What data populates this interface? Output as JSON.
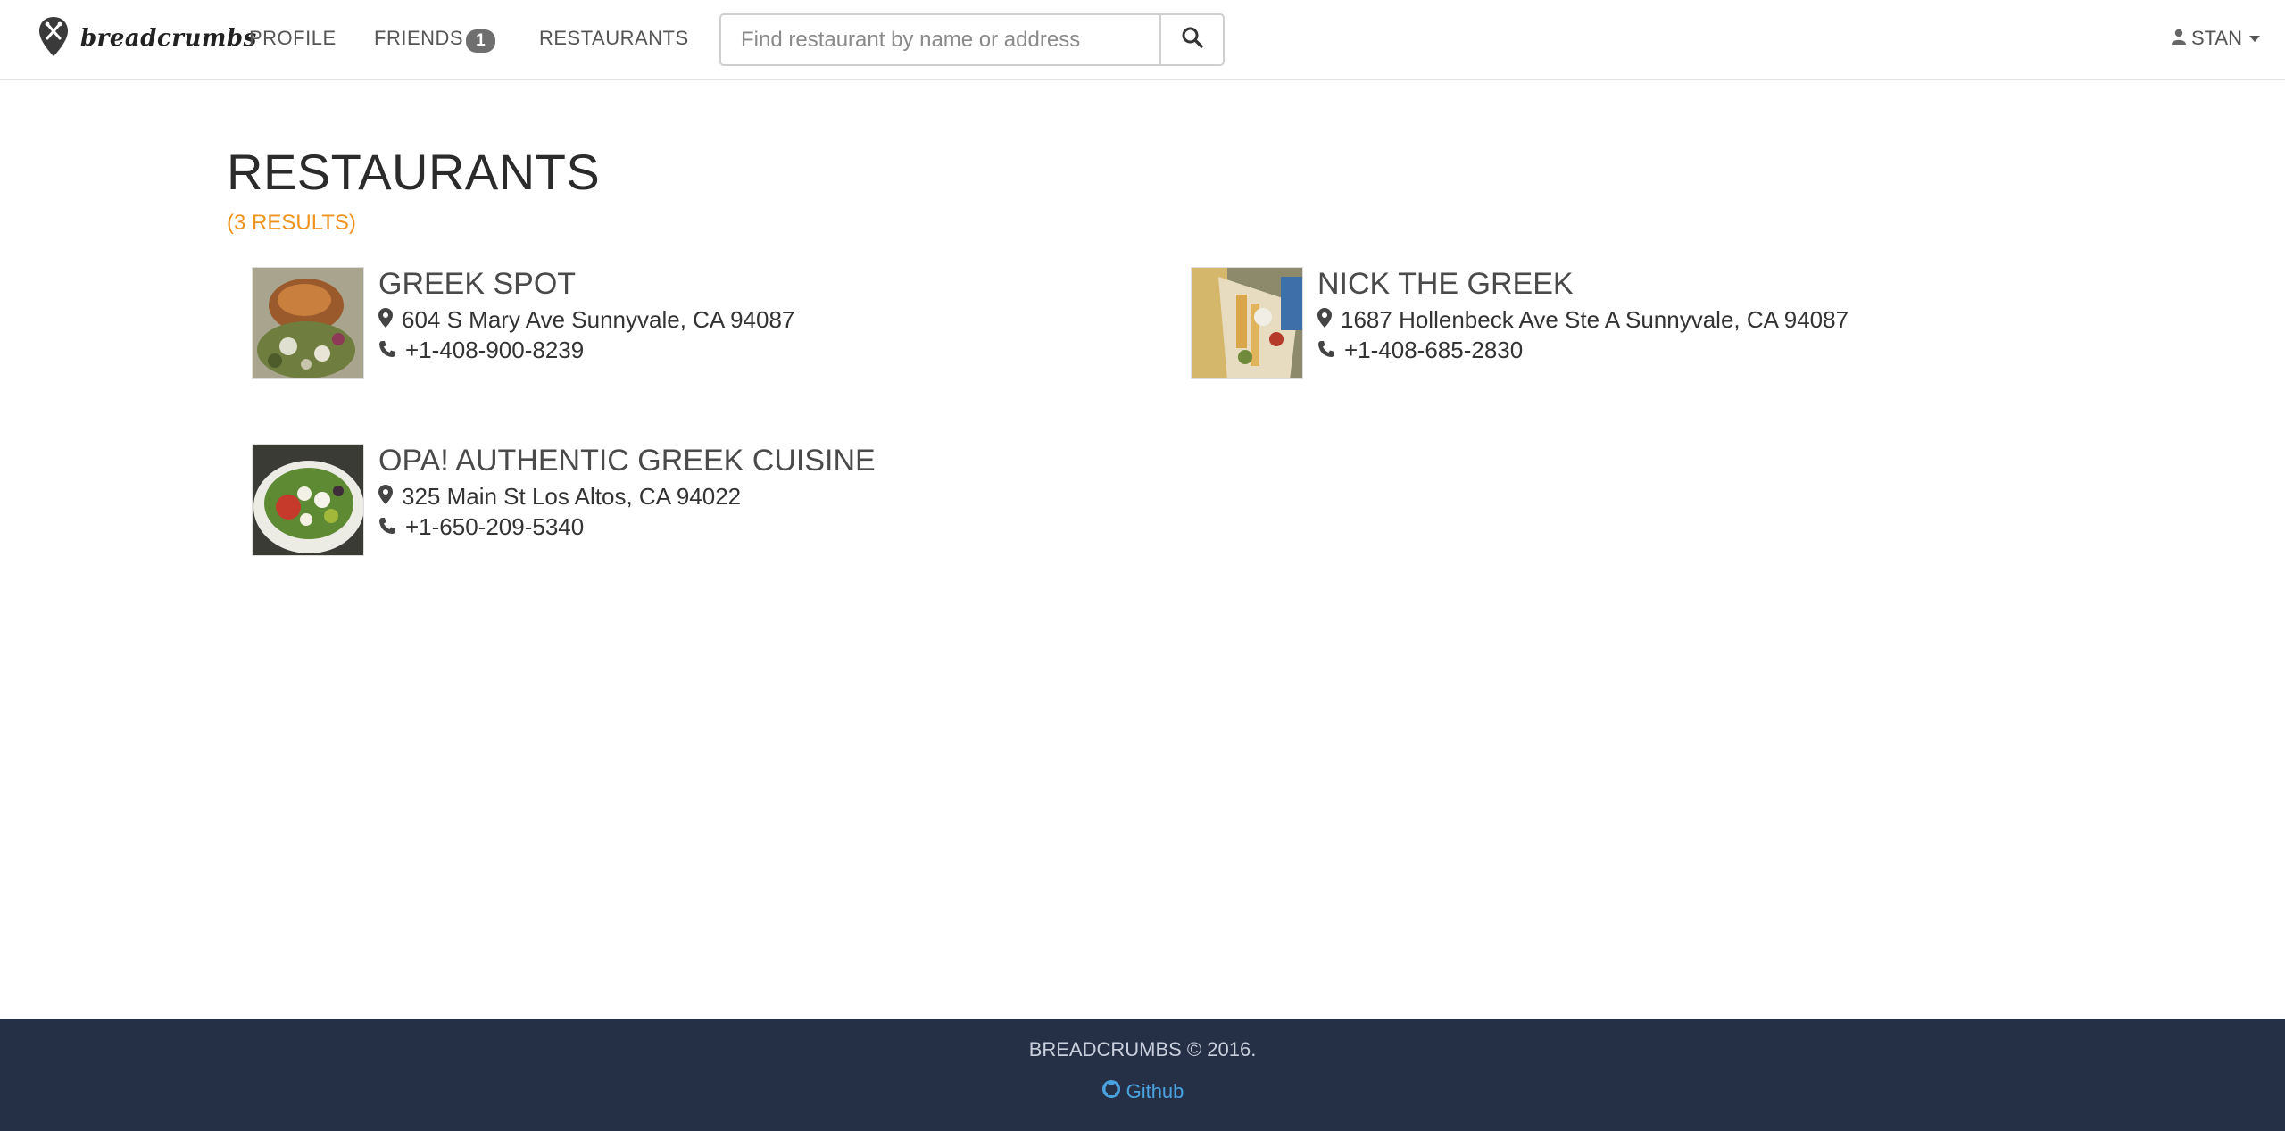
{
  "brand": {
    "name": "breadcrumbs",
    "logo_icon": "map-pin-utensils-icon"
  },
  "nav": {
    "profile": "PROFILE",
    "friends": "FRIENDS",
    "friends_badge": "1",
    "restaurants": "RESTAURANTS"
  },
  "search": {
    "placeholder": "Find restaurant by name or address",
    "value": "",
    "icon": "search-icon"
  },
  "user": {
    "name": "STAN",
    "icon": "user-icon"
  },
  "main": {
    "title": "RESTAURANTS",
    "results": "(3 RESULTS)"
  },
  "restaurants": [
    {
      "name": "GREEK SPOT",
      "address": "604 S Mary Ave Sunnyvale, CA 94087",
      "phone": "+1-408-900-8239"
    },
    {
      "name": "NICK THE GREEK",
      "address": "1687 Hollenbeck Ave Ste A Sunnyvale, CA 94087",
      "phone": "+1-408-685-2830"
    },
    {
      "name": "OPA! AUTHENTIC GREEK CUISINE",
      "address": "325 Main St Los Altos, CA 94022",
      "phone": "+1-650-209-5340"
    }
  ],
  "footer": {
    "copyright": "BREADCRUMBS © 2016.",
    "github": "Github"
  },
  "colors": {
    "accent_orange": "#f0931e",
    "footer_bg": "#253047",
    "link_blue": "#4aa3df",
    "badge_gray": "#6f6f6f"
  }
}
